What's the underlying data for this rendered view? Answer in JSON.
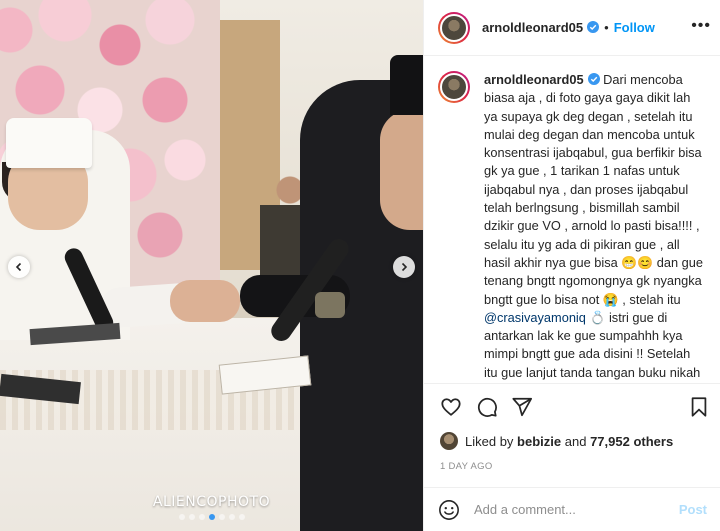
{
  "photo": {
    "watermark": "ALIENCOPHOTO",
    "prev_icon": "chevron-left-icon",
    "next_icon": "chevron-right-icon",
    "carousel_total": 7,
    "carousel_active": 4
  },
  "header": {
    "username": "arnoldleonard05",
    "separator": "•",
    "follow_label": "Follow",
    "more_label": "•••"
  },
  "caption": {
    "username": "arnoldleonard05",
    "part1": " Dari mencoba biasa aja , di foto gaya gaya dikit lah ya supaya gk deg degan , setelah itu mulai deg degan dan mencoba untuk konsentrasi ijabqabul, gua berfikir bisa gk ya gue , 1 tarikan 1 nafas untuk ijabqabul nya , dan proses ijabqabul telah berlngsung , bismillah sambil dzikir gue VO , arnold lo pasti bisa!!!! , selalu itu yg ada di pikiran gue , all hasil akhir nya gue bisa 😁😊 dan gue tenang bngtt ngomongnya gk nyangka bngtt gue lo bisa not 😭 , stelah itu ",
    "mention": "@crasivayamoniq",
    "part2": " 💍 istri gue di antarkan lak ke gue sumpahhh kya mimpi bngtt gue ada disini !! Setelah itu gue lanjut tanda tangan buku nikah dengan di saksikan orang bnyak jadi terharu gue 😭 , dan di saat itu moniq resmi jadi istri gue 😩😢😍🥰❤️🔥 ,"
  },
  "likes": {
    "prefix": "Liked by ",
    "user": "bebizie",
    "middle": " and ",
    "count": "77,952 others"
  },
  "time": "1 DAY AGO",
  "comment": {
    "placeholder": "Add a comment...",
    "post_label": "Post"
  },
  "colors": {
    "accent": "#0095f6",
    "post_disabled": "#b2dffc",
    "muted": "#8e8e8e",
    "carousel_active_dot": "#3897f0"
  }
}
